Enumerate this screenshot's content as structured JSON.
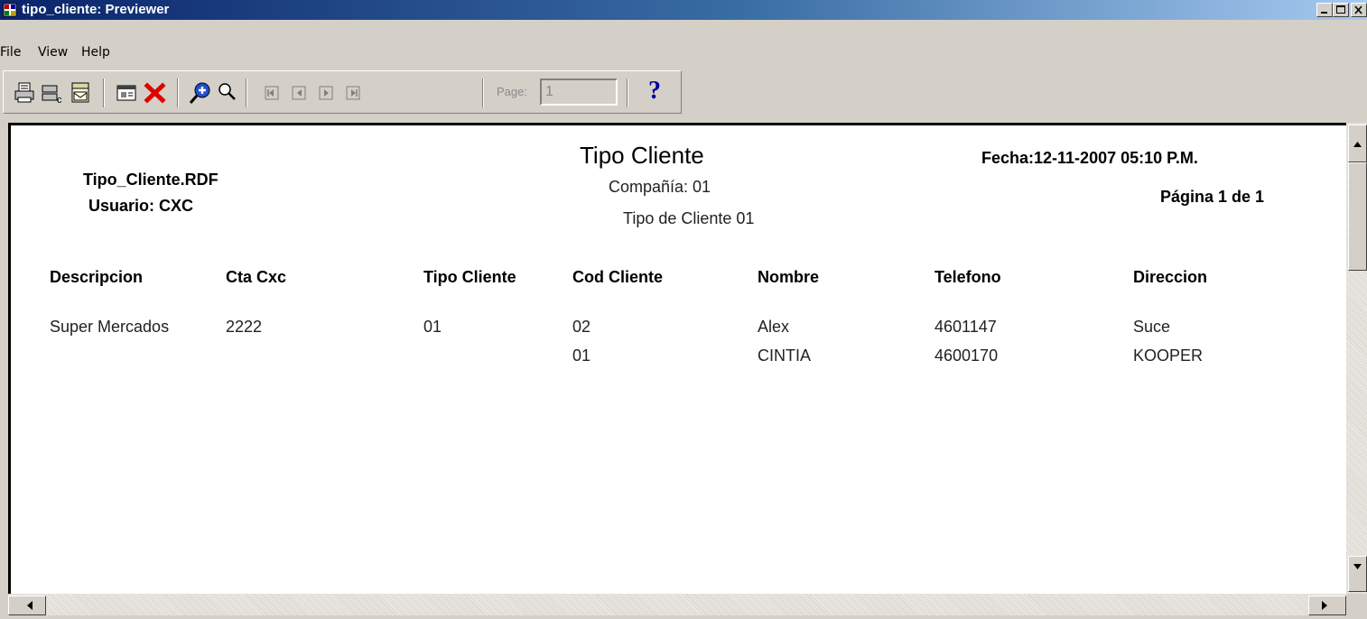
{
  "window": {
    "title": "tipo_cliente: Previewer"
  },
  "menu": [
    "File",
    "View",
    "Help"
  ],
  "toolbar": {
    "page_label": "Page:",
    "page_value": "1",
    "help_glyph": "?"
  },
  "report": {
    "file_name": "Tipo_Cliente.RDF",
    "user": "Usuario: CXC",
    "title": "Tipo Cliente",
    "company": "Compañía: 01",
    "client_type": "Tipo de Cliente 01",
    "date": "Fecha:12-11-2007 05:10 P.M.",
    "page": "Página 1 de 1",
    "columns": [
      "Descripcion",
      "Cta Cxc",
      "Tipo Cliente",
      "Cod Cliente",
      "Nombre",
      "Telefono",
      "Direccion"
    ],
    "rows": [
      [
        "Super Mercados",
        "2222",
        "01",
        "02",
        "Alex",
        "4601147",
        "Suce"
      ],
      [
        "",
        "",
        "",
        "01",
        "CINTIA",
        "4600170",
        "KOOPER"
      ]
    ]
  },
  "icons": {
    "app": "previewer-app-icon",
    "print": "print-icon",
    "print_setup": "print-setup-icon",
    "mail": "mail-icon",
    "page_setup": "page-setup-icon",
    "close": "close-red-x-icon",
    "zoom_in": "zoom-in-icon",
    "zoom_out": "zoom-out-icon",
    "first": "first-page-icon",
    "prev": "previous-page-icon",
    "next": "next-page-icon",
    "last": "last-page-icon"
  },
  "colors": {
    "titlebar_start": "#0a246a",
    "titlebar_end": "#a6caf0",
    "close_x": "#e00000",
    "help": "#0000a0"
  }
}
